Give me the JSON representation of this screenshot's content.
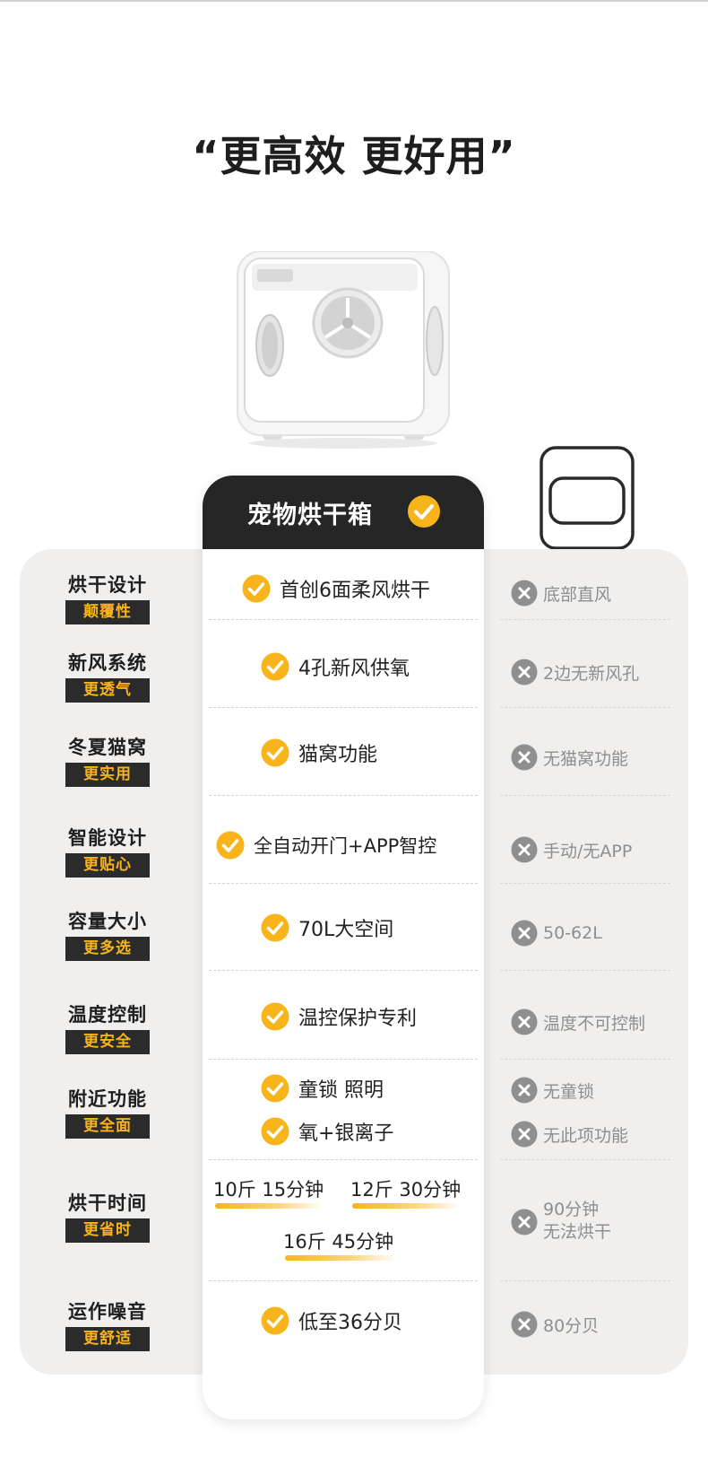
{
  "headline": "“更高效 更好用”",
  "product_column_title": "宠物烘干箱",
  "colors": {
    "accent": "#f9b41c",
    "dark": "#262626",
    "panel": "#f1efed",
    "muted": "#8e8e8e"
  },
  "rows": [
    {
      "title": "烘干设计",
      "tag": "颠覆性",
      "feature": "首创6面柔风烘干",
      "compare": "底部直风"
    },
    {
      "title": "新风系统",
      "tag": "更透气",
      "feature": "4孔新风供氧",
      "compare": "2边无新风孔"
    },
    {
      "title": "冬夏猫窝",
      "tag": "更实用",
      "feature": "猫窝功能",
      "compare": "无猫窝功能"
    },
    {
      "title": "智能设计",
      "tag": "更贴心",
      "feature": "全自动开门+APP智控",
      "compare": "手动/无APP"
    },
    {
      "title": "容量大小",
      "tag": "更多选",
      "feature": "70L大空间",
      "compare": "50-62L"
    },
    {
      "title": "温度控制",
      "tag": "更安全",
      "feature": "温控保护专利",
      "compare": "温度不可控制"
    },
    {
      "title": "附近功能",
      "tag": "更全面",
      "features": [
        "童锁 照明",
        "氧+银离子"
      ],
      "compares": [
        "无童锁",
        "无此项功能"
      ]
    },
    {
      "title": "烘干时间",
      "tag": "更省时",
      "times": [
        "10斤 15分钟",
        "12斤 30分钟",
        "16斤 45分钟"
      ],
      "compare_lines": [
        "90分钟",
        "无法烘干"
      ]
    },
    {
      "title": "运作噪音",
      "tag": "更舒适",
      "feature": "低至36分贝",
      "compare": "80分贝"
    }
  ]
}
